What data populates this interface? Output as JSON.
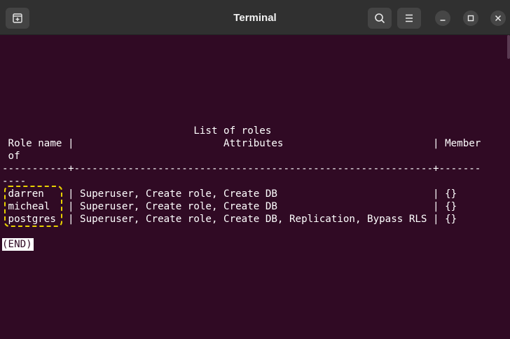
{
  "window": {
    "title": "Terminal"
  },
  "icons": {
    "new_tab": "new-tab-icon",
    "search": "search-icon",
    "menu": "hamburger-menu-icon",
    "minimize": "minimize-icon",
    "maximize": "maximize-icon",
    "close": "close-icon"
  },
  "colors": {
    "terminal_background": "#300a24",
    "titlebar_background": "#303030",
    "text": "#ffffff",
    "highlight_border": "#e8d100"
  },
  "terminal": {
    "lines": [
      "                                List of roles",
      " Role name |                         Attributes                         | Member",
      " of",
      "-----------+------------------------------------------------------------+-------",
      "----",
      " darren    | Superuser, Create role, Create DB                          | {}",
      " micheal   | Superuser, Create role, Create DB                          | {}",
      " postgres  | Superuser, Create role, Create DB, Replication, Bypass RLS | {}",
      "",
      "(END)"
    ]
  }
}
